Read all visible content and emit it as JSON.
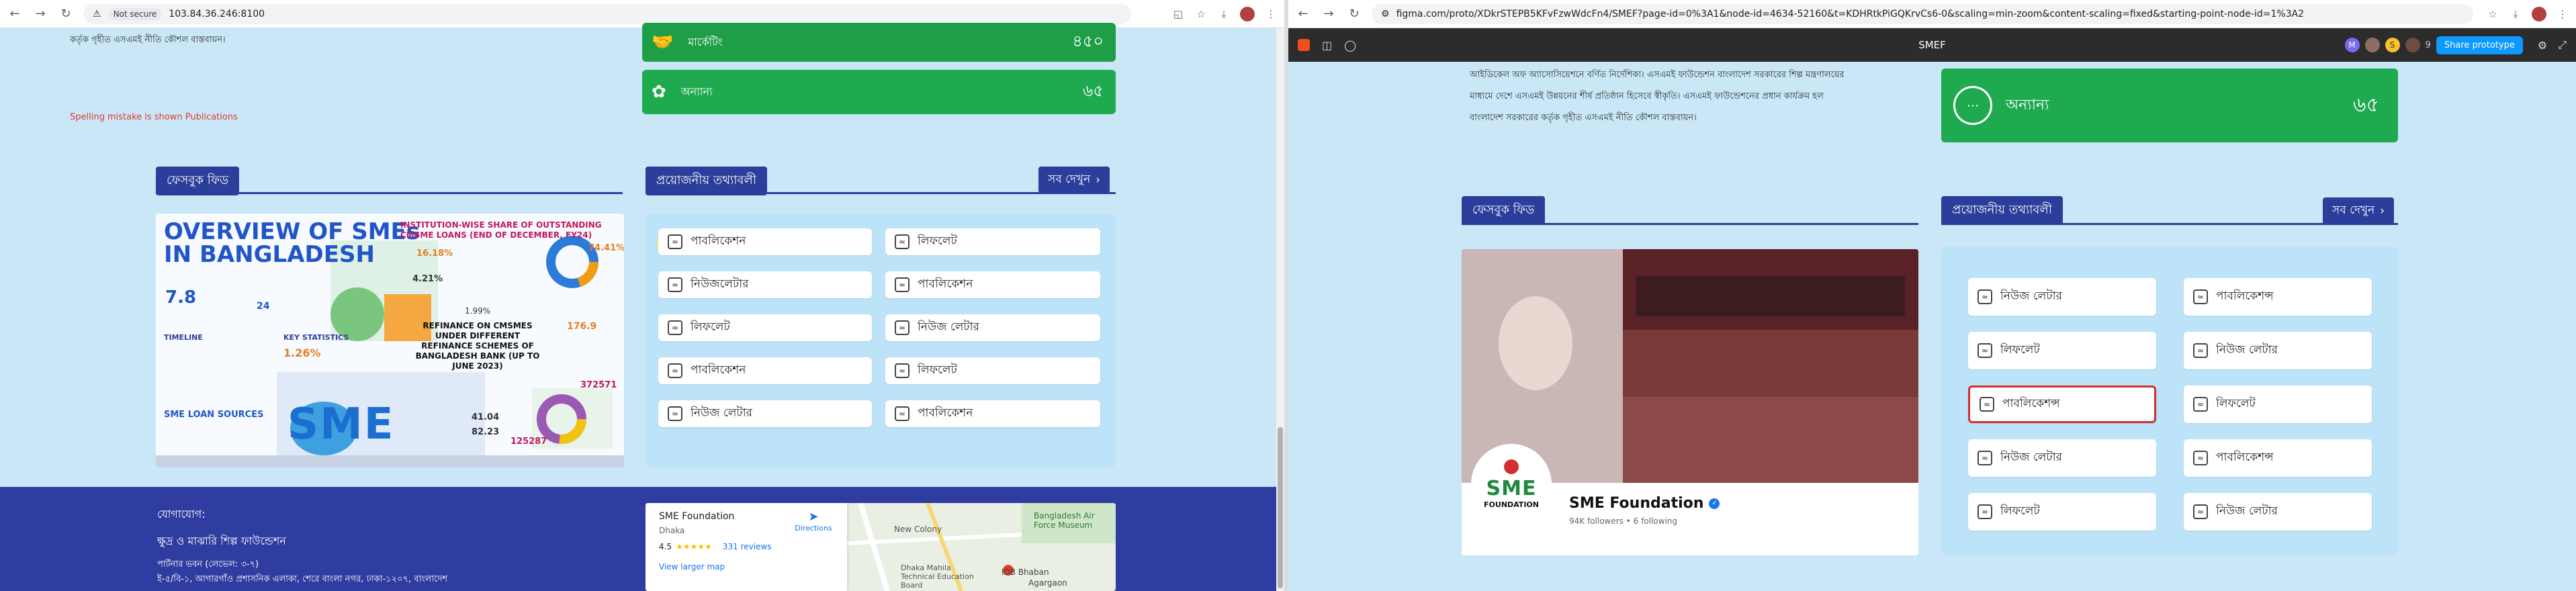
{
  "left": {
    "chrome": {
      "security_label": "Not secure",
      "url": "103.84.36.246:8100"
    },
    "intro_text": "কর্তৃক গৃহীত এসএমই নীতি কৌশল বাস্তবায়ন।",
    "review_note": "Spelling mistake is shown Publications",
    "stat_cards": [
      {
        "label": "মার্কেটিং",
        "value": "৪৫০",
        "color": "#1f9e48"
      },
      {
        "label": "অন্যান্য",
        "value": "৬৫",
        "color": "#1faa4f"
      }
    ],
    "facebook_section": {
      "title": "ফেসবুক ফিড"
    },
    "facebook_image": {
      "title_line1": "OVERVIEW OF SMEs",
      "title_line2": "IN BANGLADESH",
      "loans_heading": "INSTITUTION-WISE SHARE OF OUTSTANDING CMSME LOANS (END OF DECEMBER, FY24)",
      "pct_a": "16.18%",
      "pct_b": "74.41%",
      "pct_c": "4.21%",
      "pct_d": "1.99%",
      "stat_big": "7.8",
      "stat_24": "24",
      "timeline_label": "TIMELINE",
      "key_stats_label": "KEY STATISTICS",
      "key_stat_1": "1.26%",
      "refinance_text": "REFINANCE ON CMSMES UNDER DIFFERENT REFINANCE SCHEMES OF BANGLADESH BANK (UP TO JUNE 2023)",
      "refinance_value": "176.9",
      "loan_sources_label": "SME LOAN SOURCES",
      "logo_text": "SME",
      "num_372571": "372571",
      "num_125287": "125287",
      "num_41_04": "41.04",
      "num_82_23": "82.23"
    },
    "info_section": {
      "title": "প্রয়োজনীয় তথ্যাবলী",
      "view_all": "সব দেখুন",
      "items": [
        {
          "label": "পাবলিকেশন"
        },
        {
          "label": "লিফলেট"
        },
        {
          "label": "নিউজলেটার"
        },
        {
          "label": "পাবলিকেশন"
        },
        {
          "label": "লিফলেট"
        },
        {
          "label": "নিউজ লেটার"
        },
        {
          "label": "পাবলিকেশন"
        },
        {
          "label": "লিফলেট"
        },
        {
          "label": "নিউজ লেটার"
        },
        {
          "label": "পাবলিকেশন"
        }
      ]
    },
    "footer": {
      "contact_heading": "যোগাযোগ:",
      "org_name": "ক্ষুদ্র ও মাঝারি শিল্প ফাউন্ডেশন",
      "line1": "পার্টনার ভবন (লেভেল: ৩-৭)",
      "line2": "ই-৫/বি-১, আগারগাঁও প্রশাসনিক এলাকা, শেরে বাংলা নগর, ঢাকা-১২০৭, বাংলাদেশ"
    },
    "map": {
      "place_name": "SME Foundation",
      "place_sub": "Dhaka",
      "rating": "4.5",
      "stars": "★★★★★",
      "reviews": "331 reviews",
      "directions": "Directions",
      "larger_map": "View larger map",
      "poi_1": "New Colony",
      "poi_2": "Bangladesh Air Force Museum",
      "poi_3": "IDB Bhaban",
      "poi_4": "Agargaon",
      "poi_5": "Dhaka Mahila Technical Education Board"
    }
  },
  "right": {
    "chrome": {
      "url": "figma.com/proto/XDkrSTEPB5KFvFzwWdcFn4/SMEF?page-id=0%3A1&node-id=4634-52160&t=KDHRtkPiGQKrvCs6-0&scaling=min-zoom&content-scaling=fixed&starting-point-node-id=1%3A2"
    },
    "figma": {
      "file_name": "SMEF",
      "share_label": "Share prototype",
      "avatar_letters": [
        "M",
        "S"
      ],
      "zoom_count": "9"
    },
    "intro_text_1": "আইডিকেল অফ অ্যাসোসিয়েশনে বর্ণিত নির্দেশিকা। এসএমই ফাউন্ডেশন বাংলাদেশ সরকারের শিল্প মন্ত্রণালয়ের",
    "intro_text_2": "মাধ্যমে দেশে এসএমই উন্নয়নের শীর্ষ প্রতিষ্ঠান হিসেবে স্বীকৃতি। এসএমই ফাউন্ডেশনের প্রধান কার্যক্রম হল",
    "intro_text_3": "বাংলাদেশ সরকারের কর্তৃক গৃহীত এসএমই নীতি কৌশল বাস্তবায়ন।",
    "stat_card": {
      "label": "অন্যান্য",
      "value": "৬৫",
      "color": "#1faa4f"
    },
    "facebook_section": {
      "title": "ফেসবুক ফিড"
    },
    "fb_page": {
      "name": "SME Foundation",
      "meta": "94K followers • 6 following",
      "logo_text": "SME",
      "logo_sub": "FOUNDATION"
    },
    "info_section": {
      "title": "প্রয়োজনীয় তথ্যাবলী",
      "view_all": "সব দেখুন",
      "items": [
        {
          "label": "নিউজ লেটার"
        },
        {
          "label": "পাবলিকেশন্স"
        },
        {
          "label": "লিফলেট"
        },
        {
          "label": "নিউজ লেটার"
        },
        {
          "label": "পাবলিকেশন্স"
        },
        {
          "label": "লিফলেট"
        },
        {
          "label": "নিউজ লেটার"
        },
        {
          "label": "পাবলিকেশন্স"
        },
        {
          "label": "লিফলেট"
        },
        {
          "label": "নিউজ লেটার"
        }
      ]
    }
  }
}
